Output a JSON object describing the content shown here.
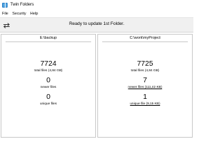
{
  "window": {
    "title": "Twin Folders"
  },
  "menu": [
    "File",
    "Security",
    "Help"
  ],
  "toolbar": {
    "sync_icon": "sync-arrows-icon",
    "status": "Ready to update 1st Folder."
  },
  "left": {
    "path": "E:\\backup",
    "total": "7724",
    "total_label": "total files (4,84 GB)",
    "newer": "0",
    "newer_label": "newer files",
    "unique": "0",
    "unique_label": "unique files"
  },
  "right": {
    "path": "C:\\work\\myProject",
    "total": "7725",
    "total_label": "total files (4,84 GB)",
    "newer": "7",
    "newer_label": "newer files (111,42 KB)",
    "unique": "1",
    "unique_label": "unique file (9,15 KB)"
  }
}
